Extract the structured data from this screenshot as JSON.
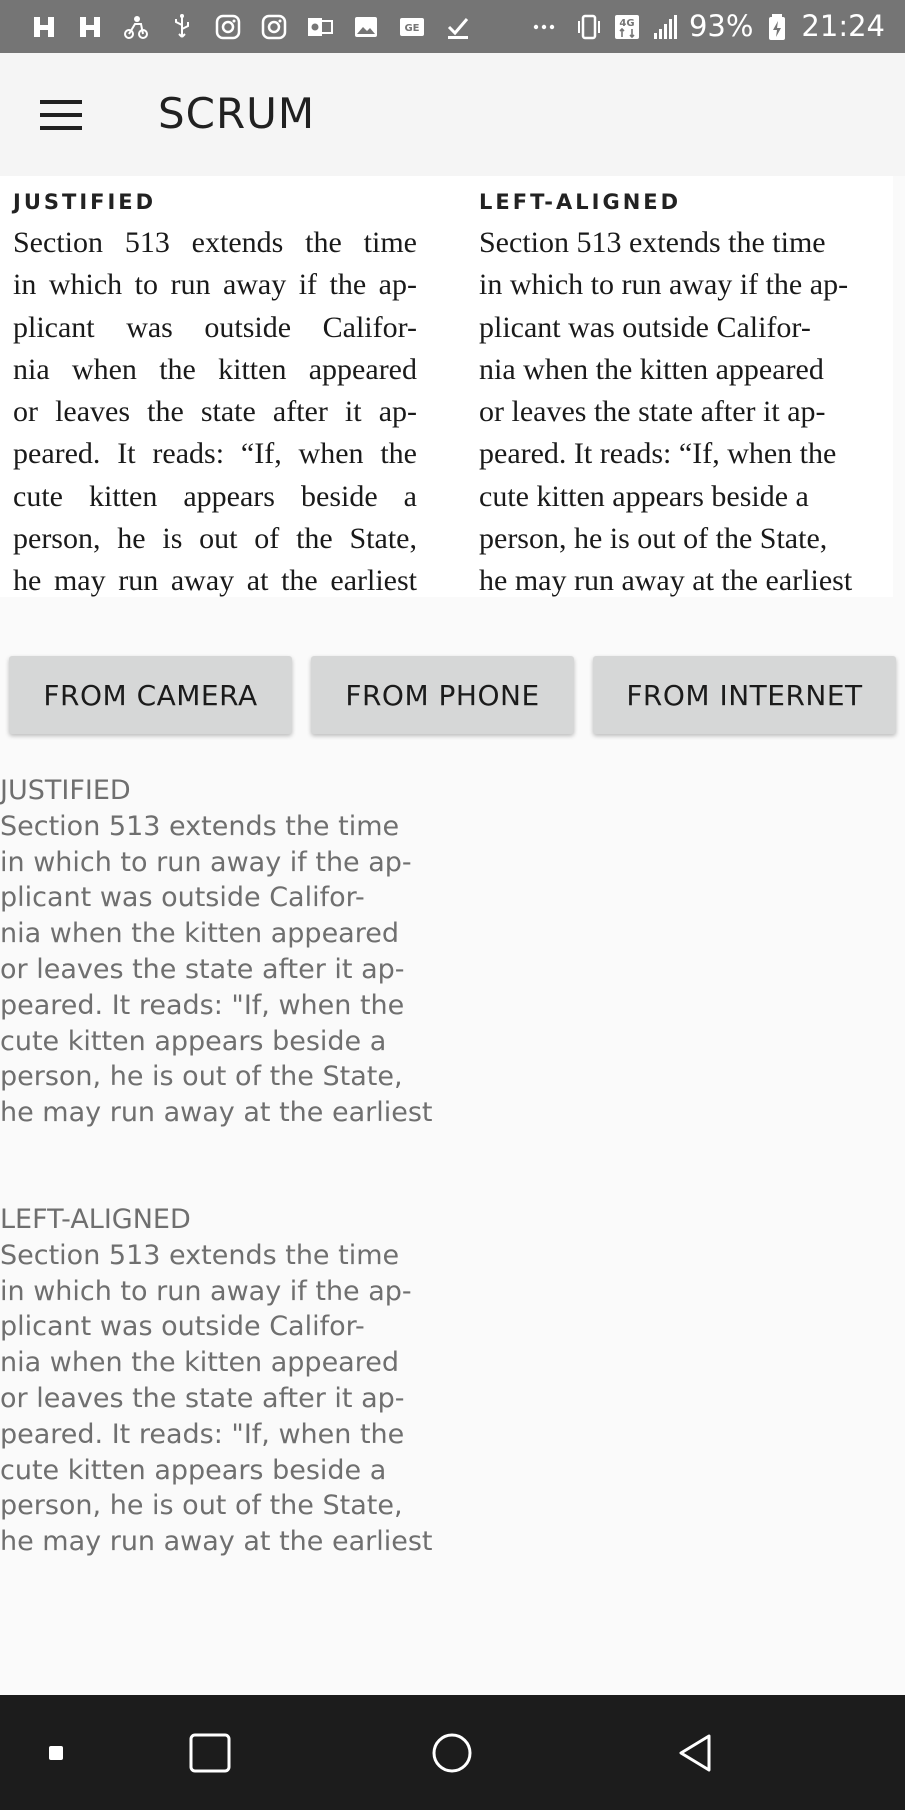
{
  "status_bar": {
    "battery": "93%",
    "time": "21:24",
    "icons_left": [
      "h-app-icon",
      "h-app-icon",
      "scooter-icon",
      "usb-icon",
      "instagram-icon",
      "instagram-icon",
      "outlook-icon",
      "gallery-icon",
      "ge-icon",
      "download-done-icon",
      "more-icon"
    ],
    "icons_right": [
      "vibrate-icon",
      "4g-icon",
      "signal-icon",
      "battery-charging-icon"
    ]
  },
  "app_bar": {
    "title": "SCRUM",
    "menu_icon": "hamburger-menu-icon"
  },
  "sample_image": {
    "left_heading": "JUSTIFIED",
    "right_heading": "LEFT-ALIGNED",
    "lines": [
      "Section 513 extends the time",
      "in which to run away if the ap-",
      "plicant was outside Califor-",
      "nia when the kitten appeared",
      "or leaves the state after it ap-",
      "peared. It reads: “If, when the",
      "cute kitten appears beside a",
      "person, he is out of the State,",
      "he may run away at the earliest"
    ]
  },
  "buttons": {
    "camera": "FROM CAMERA",
    "phone": "FROM PHONE",
    "internet": "FROM INTERNET"
  },
  "ocr_result": {
    "block1": {
      "heading": "JUSTIFIED",
      "lines": [
        "Section 513 extends the time",
        "in which to run away if the ap-",
        "plicant was outside Califor-",
        "nia when the kitten appeared",
        "or leaves the state after it ap-",
        "peared. It reads: \"If, when the",
        "cute kitten appears beside a",
        "person, he is out of the State,",
        "he may run away at the earliest"
      ]
    },
    "block2": {
      "heading": "LEFT-ALIGNED",
      "lines": [
        "Section 513 extends the time",
        "in which to run away if the ap-",
        "plicant was outside Califor-",
        "nia when the kitten appeared",
        "or leaves the state after it ap-",
        "peared. It reads: \"If, when the",
        "cute kitten appears beside a",
        "person, he is out of the State,",
        "he may run away at the earliest"
      ]
    }
  },
  "nav_bar": {
    "icons": [
      "assistant-dot-icon",
      "recents-icon",
      "home-icon",
      "back-icon"
    ]
  },
  "colors": {
    "status_bar_bg": "#757575",
    "app_bar_bg": "#f5f5f5",
    "button_bg": "#d6d7d7",
    "ocr_text": "#6f6f6f",
    "nav_bar_bg": "#1c1c1c"
  }
}
